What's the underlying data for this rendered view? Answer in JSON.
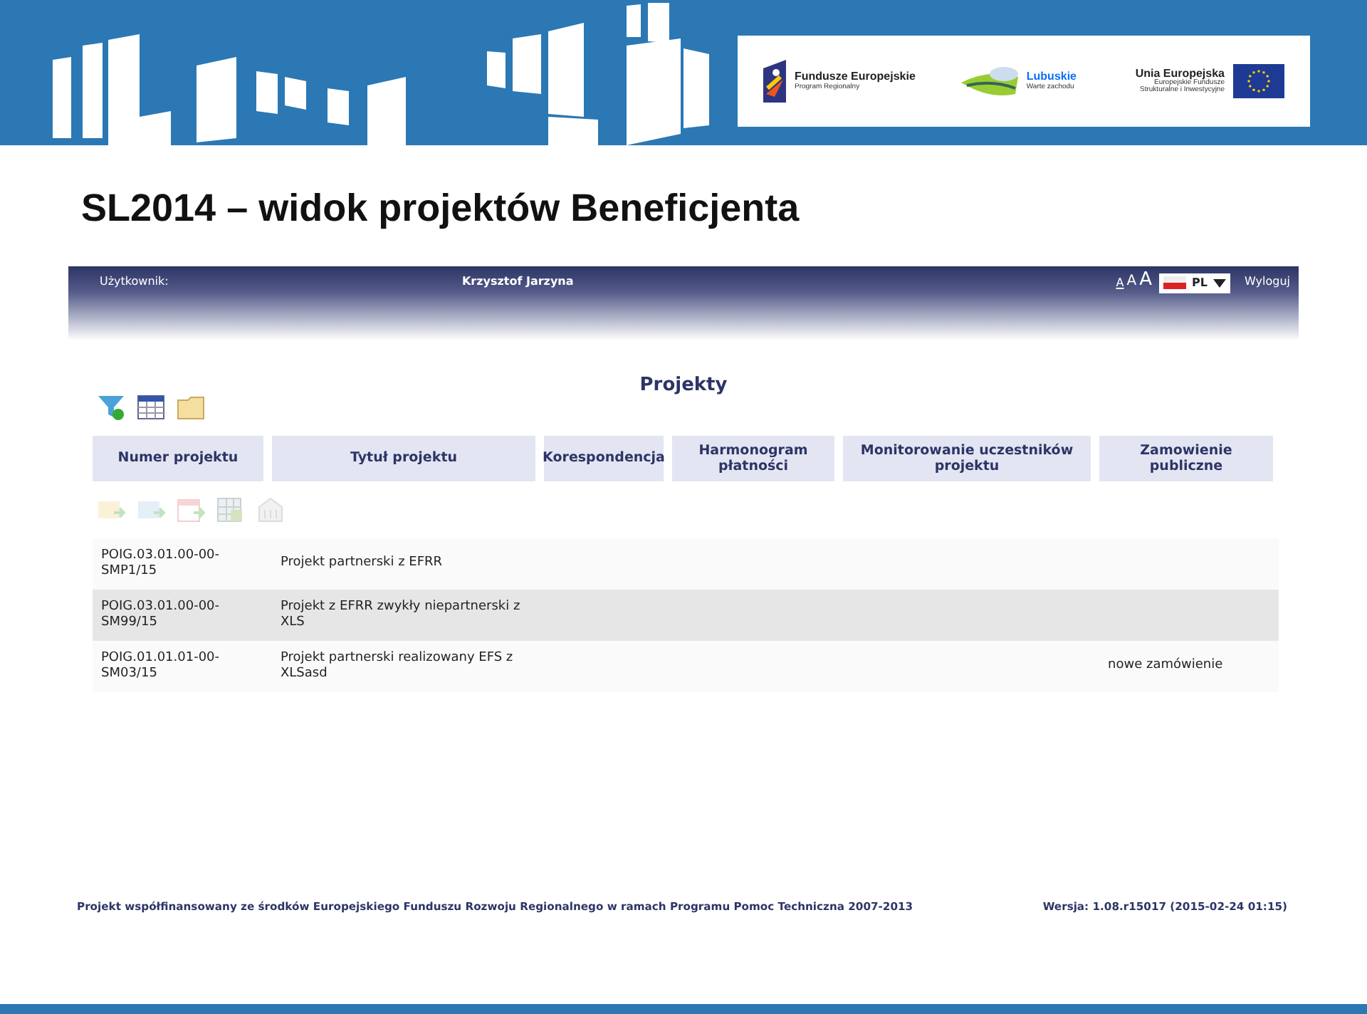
{
  "banner": {
    "logos": [
      {
        "kind": "fe",
        "lines": [
          "Fundusze",
          "Europejskie"
        ],
        "sub": "Program Regionalny"
      },
      {
        "kind": "lub",
        "lines": [
          "Lubuskie"
        ],
        "sub": "Warte zachodu"
      },
      {
        "kind": "ue",
        "lines": [
          "Unia Europejska"
        ],
        "sub": "Europejskie Fundusze Strukturalne i Inwestycyjne"
      }
    ]
  },
  "slide_title": "SL2014 – widok projektów Beneficjenta",
  "user_bar": {
    "user_label": "Użytkownik:",
    "user_name": "Krzysztof Jarzyna",
    "font_sizes": [
      {
        "label": "A",
        "selected": true
      },
      {
        "label": "A",
        "selected": false
      },
      {
        "label": "A",
        "selected": false
      }
    ],
    "language": "PL",
    "logout": "Wyloguj"
  },
  "page_title": "Projekty",
  "toolbar": [
    {
      "kind": "filter",
      "disabled": false
    },
    {
      "kind": "table",
      "disabled": false
    },
    {
      "kind": "folder",
      "disabled": false
    }
  ],
  "columns": [
    "Numer projektu",
    "Tytuł projektu",
    "Korespondencja",
    "Harmonogram płatności",
    "Monitorowanie uczestników projektu",
    "Zamowienie publiczne"
  ],
  "actions": [
    {
      "kind": "mail",
      "disabled": true
    },
    {
      "kind": "send",
      "disabled": true
    },
    {
      "kind": "calendar",
      "disabled": true
    },
    {
      "kind": "grid",
      "disabled": true
    },
    {
      "kind": "building",
      "disabled": true
    }
  ],
  "rows": [
    {
      "cells": [
        "POIG.03.01.00-00-SMP1/15",
        "Projekt partnerski z EFRR",
        "",
        "",
        "",
        ""
      ],
      "selected": false
    },
    {
      "cells": [
        "POIG.03.01.00-00-SM99/15",
        "Projekt z EFRR zwykły niepartnerski z XLS",
        "",
        "",
        "",
        ""
      ],
      "selected": true
    },
    {
      "cells": [
        "POIG.01.01.01-00-SM03/15",
        "Projekt partnerski realizowany EFS z XLSasd",
        "",
        "",
        "",
        "nowe zamówienie"
      ],
      "selected": false
    }
  ],
  "footer": {
    "left": "Projekt współfinansowany ze środków Europejskiego Funduszu Rozwoju Regionalnego w ramach Programu Pomoc Techniczna 2007-2013",
    "right": "Wersja: 1.08.r15017 (2015-02-24 01:15)"
  }
}
